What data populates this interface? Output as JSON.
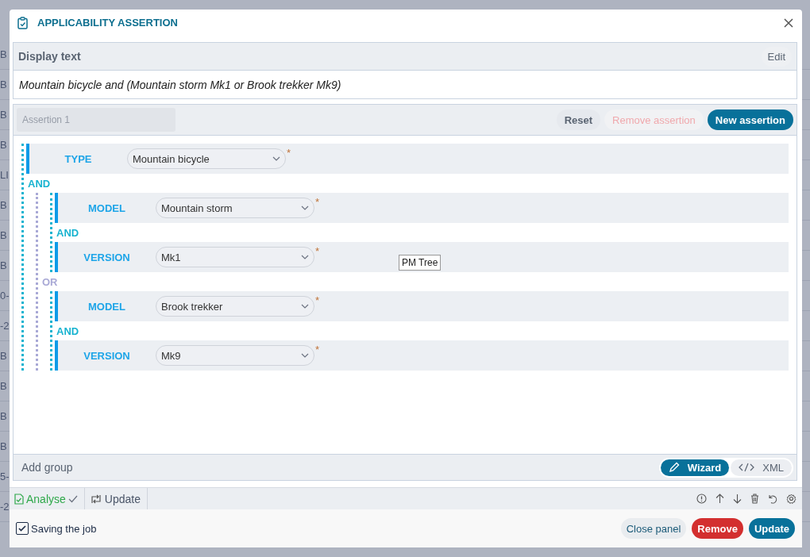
{
  "background": {
    "left_fragments": [
      "B",
      "B",
      "B",
      "B",
      "LI",
      "B",
      "B",
      "B",
      "0-",
      "-2",
      "B",
      "B",
      "B",
      "B",
      "5-",
      "-2"
    ]
  },
  "dialog": {
    "title": "APPLICABILITY ASSERTION"
  },
  "display_text": {
    "heading": "Display text",
    "edit_button": "Edit",
    "text": "Mountain bicycle and (Mountain storm Mk1 or Brook trekker Mk9)"
  },
  "assertion": {
    "name_placeholder": "Assertion 1",
    "buttons": [
      {
        "label": "Reset",
        "kind": "plain",
        "disabled": false
      },
      {
        "label": "Remove assertion",
        "kind": "plain",
        "disabled": true
      },
      {
        "label": "New assertion",
        "kind": "primary",
        "disabled": false
      }
    ],
    "tree": {
      "kind": "group",
      "operator": "AND",
      "color": "#17b3d0",
      "children": [
        {
          "kind": "condition",
          "label": "TYPE",
          "value": "Mountain bicycle",
          "required_mark": "*"
        },
        {
          "kind": "group",
          "operator": "OR",
          "color": "#a9a9d6",
          "children": [
            {
              "kind": "group",
              "operator": "AND",
              "color": "#17b3d0",
              "children": [
                {
                  "kind": "condition",
                  "label": "MODEL",
                  "value": "Mountain storm",
                  "required_mark": "*"
                },
                {
                  "kind": "condition",
                  "label": "VERSION",
                  "value": "Mk1",
                  "required_mark": "*"
                }
              ]
            },
            {
              "kind": "group",
              "operator": "AND",
              "color": "#17b3d0",
              "children": [
                {
                  "kind": "condition",
                  "label": "MODEL",
                  "value": "Brook trekker",
                  "required_mark": "*"
                },
                {
                  "kind": "condition",
                  "label": "VERSION",
                  "value": "Mk9",
                  "required_mark": "*"
                }
              ]
            }
          ]
        }
      ]
    },
    "tooltip": "PM Tree",
    "add_group": "Add group",
    "modes": [
      {
        "label": "Wizard",
        "kind": "wizard",
        "selected": true
      },
      {
        "label": "XML",
        "kind": "xml",
        "selected": false
      }
    ]
  },
  "toolbar": {
    "analyse": "Analyse",
    "update": "Update"
  },
  "footer": {
    "checkbox": {
      "label": "Saving the job",
      "checked": true
    },
    "buttons": [
      {
        "label": "Close panel",
        "kind": "plain"
      },
      {
        "label": "Remove",
        "kind": "danger"
      },
      {
        "label": "Update",
        "kind": "primary"
      }
    ]
  }
}
